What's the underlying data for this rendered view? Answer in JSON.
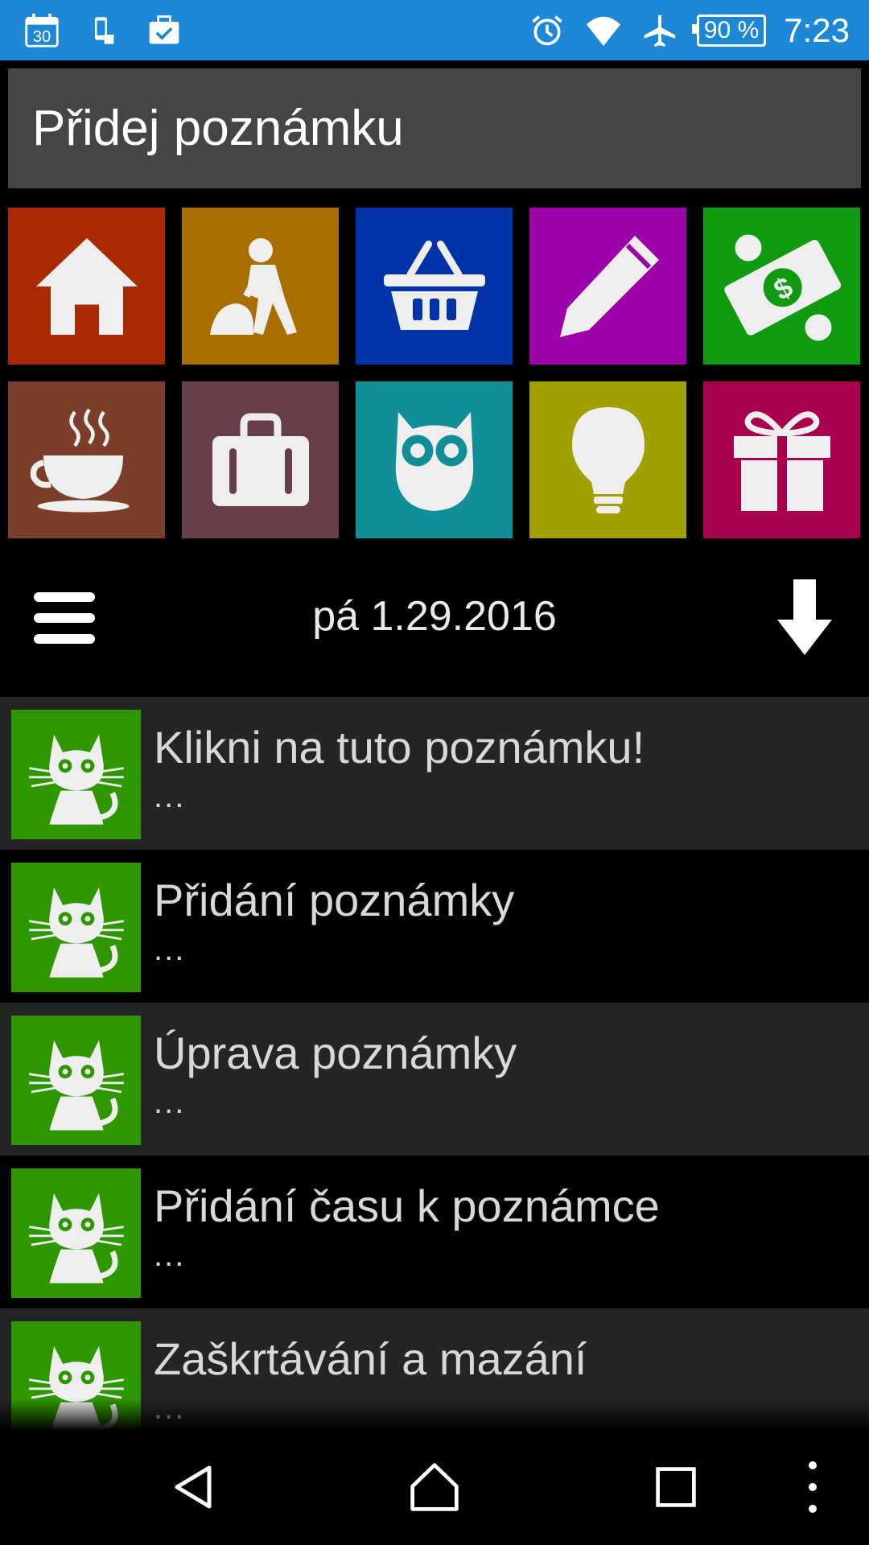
{
  "status_bar": {
    "left_icons": [
      "calendar-30-icon",
      "phone-vibrate-icon",
      "briefcase-check-icon"
    ],
    "calendar_day": "30",
    "battery": "90 %",
    "time": "7:23"
  },
  "title_input": {
    "value": "Přidej poznámku"
  },
  "categories": [
    {
      "name": "home",
      "icon": "house-icon",
      "color": "#a92a00"
    },
    {
      "name": "work",
      "icon": "worker-shovel-icon",
      "color": "#a86f00"
    },
    {
      "name": "shopping",
      "icon": "basket-icon",
      "color": "#0032a8"
    },
    {
      "name": "write",
      "icon": "pencil-icon",
      "color": "#9b00a9"
    },
    {
      "name": "money",
      "icon": "money-icon",
      "color": "#109a10"
    },
    {
      "name": "coffee",
      "icon": "coffee-cup-icon",
      "color": "#7b3e2a"
    },
    {
      "name": "travel",
      "icon": "suitcase-icon",
      "color": "#663f4a"
    },
    {
      "name": "school",
      "icon": "owl-icon",
      "color": "#128e97"
    },
    {
      "name": "idea",
      "icon": "lightbulb-icon",
      "color": "#a0a000"
    },
    {
      "name": "gift",
      "icon": "gift-icon",
      "color": "#a8004f"
    }
  ],
  "toolbar": {
    "date": "pá 1.29.2016"
  },
  "notes": [
    {
      "title": "Klikni na tuto poznámku!",
      "sub": "..."
    },
    {
      "title": "Přidání poznámky",
      "sub": "..."
    },
    {
      "title": "Úprava poznámky",
      "sub": "..."
    },
    {
      "title": "Přidání času k poznámce",
      "sub": "..."
    },
    {
      "title": "Zaškrtávání a mazání",
      "sub": "..."
    }
  ]
}
